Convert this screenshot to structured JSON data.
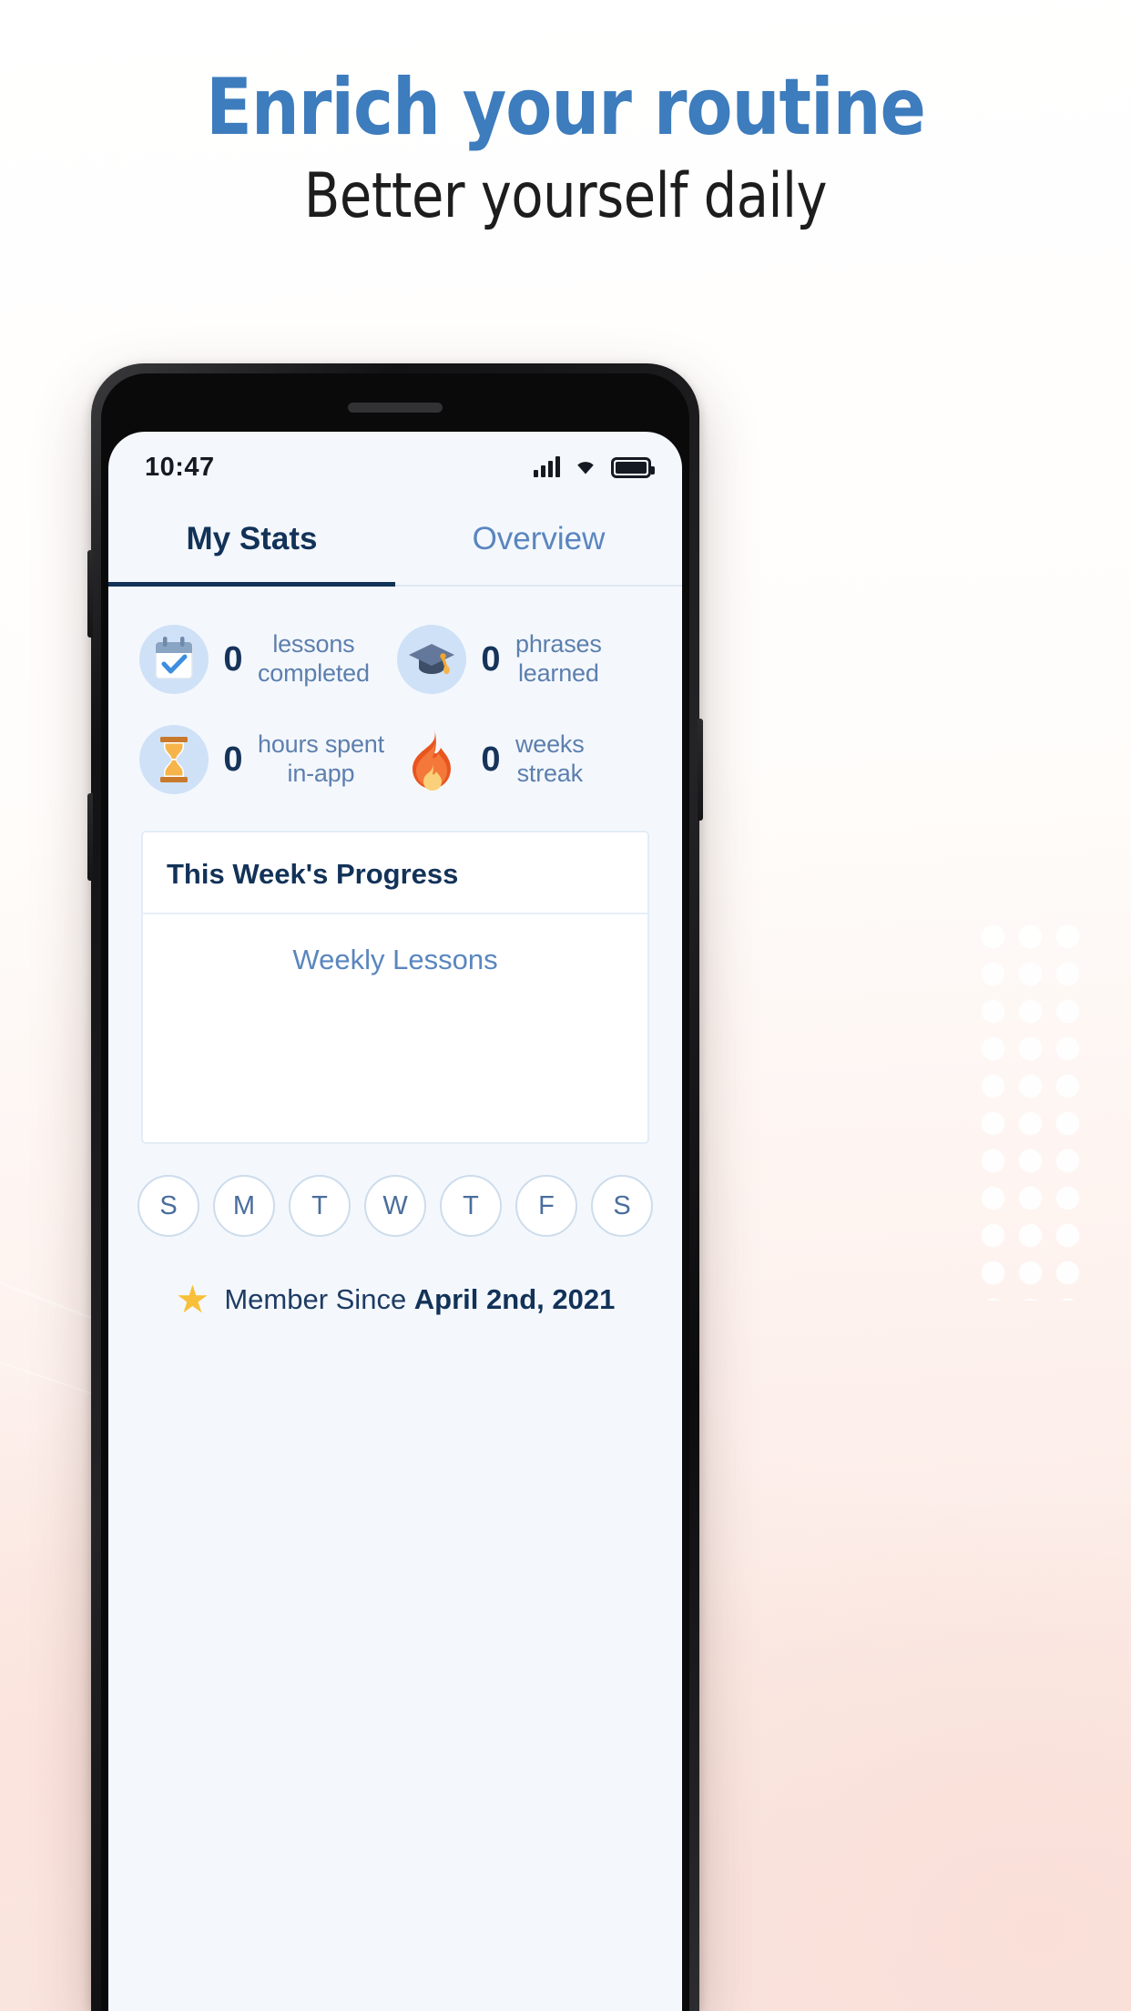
{
  "hero": {
    "title": "Enrich your routine",
    "subtitle": "Better yourself daily",
    "title_color": "#3d7cbd",
    "subtitle_color": "#1d1d1d"
  },
  "status_bar": {
    "time": "10:47",
    "signal_icon": "cellular-signal-icon",
    "wifi_icon": "wifi-icon",
    "battery_icon": "battery-full-icon"
  },
  "tabs": [
    {
      "label": "My Stats",
      "active": true
    },
    {
      "label": "Overview",
      "active": false
    }
  ],
  "stats": [
    {
      "icon": "calendar-check-icon",
      "value": "0",
      "label": "lessons\ncompleted",
      "label_line1": "lessons",
      "label_line2": "completed"
    },
    {
      "icon": "graduation-cap-icon",
      "value": "0",
      "label": "phrases\nlearned",
      "label_line1": "phrases",
      "label_line2": "learned"
    },
    {
      "icon": "hourglass-icon",
      "value": "0",
      "label": "hours spent\nin-app",
      "label_line1": "hours spent",
      "label_line2": "in-app"
    },
    {
      "icon": "flame-icon",
      "value": "0",
      "label": "weeks\nstreak",
      "label_line1": "weeks",
      "label_line2": "streak"
    }
  ],
  "progress_card": {
    "title": "This Week's Progress",
    "chart_label": "Weekly Lessons"
  },
  "chart_data": {
    "type": "bar",
    "title": "Weekly Lessons",
    "categories": [
      "S",
      "M",
      "T",
      "W",
      "T",
      "F",
      "S"
    ],
    "values": [
      0,
      0,
      0,
      0,
      0,
      0,
      0
    ],
    "xlabel": "",
    "ylabel": "",
    "ylim": [
      0,
      0
    ],
    "grid": false,
    "legend": "none"
  },
  "days": [
    "S",
    "M",
    "T",
    "W",
    "T",
    "F",
    "S"
  ],
  "member": {
    "icon": "star-icon",
    "prefix": "Member Since ",
    "date": "April 2nd, 2021"
  },
  "colors": {
    "accent_blue": "#3d7cbd",
    "navy": "#123258",
    "muted_blue": "#5d7fae",
    "icon_bg": "#cfe1f7",
    "star_yellow": "#f8c03a",
    "flame_orange": "#ec5f2b"
  }
}
